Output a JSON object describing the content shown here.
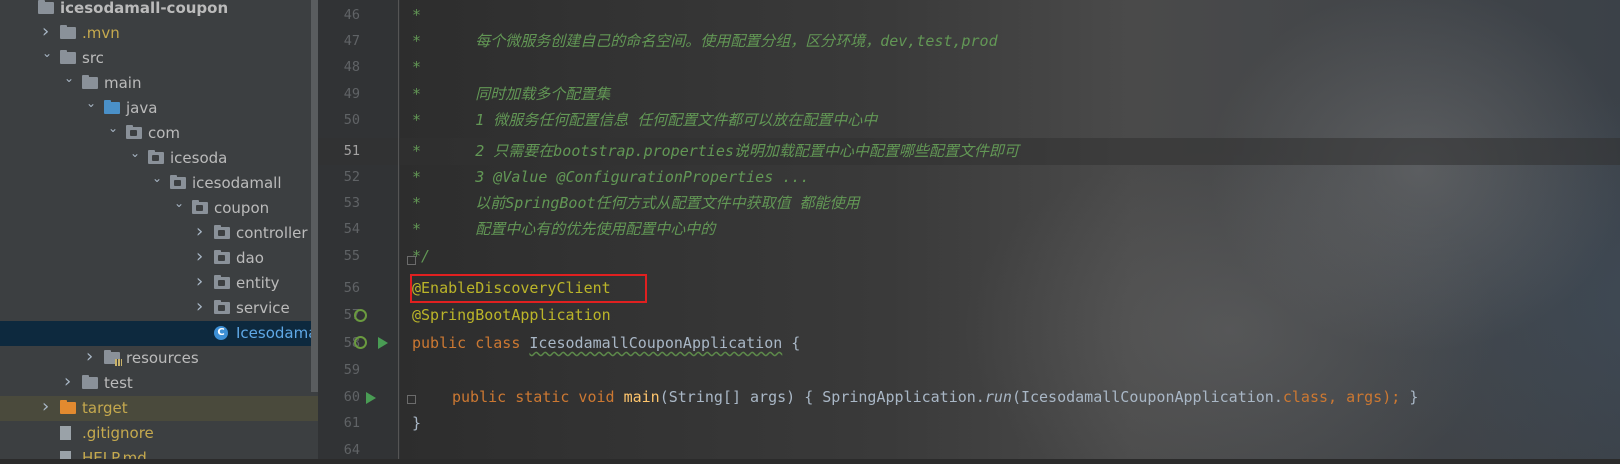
{
  "project_tree": {
    "items": [
      {
        "label": "icesodamall-coupon",
        "depth": 0,
        "arrow": "",
        "icon": "module-folder",
        "bold": true
      },
      {
        "label": ".mvn",
        "depth": 1,
        "arrow": "right",
        "icon": "folder",
        "color": "#c5a94e"
      },
      {
        "label": "src",
        "depth": 1,
        "arrow": "down",
        "icon": "folder"
      },
      {
        "label": "main",
        "depth": 2,
        "arrow": "down",
        "icon": "folder"
      },
      {
        "label": "java",
        "depth": 3,
        "arrow": "down",
        "icon": "source-folder"
      },
      {
        "label": "com",
        "depth": 4,
        "arrow": "down",
        "icon": "package"
      },
      {
        "label": "icesoda",
        "depth": 5,
        "arrow": "down",
        "icon": "package"
      },
      {
        "label": "icesodamall",
        "depth": 6,
        "arrow": "down",
        "icon": "package"
      },
      {
        "label": "coupon",
        "depth": 7,
        "arrow": "down",
        "icon": "package"
      },
      {
        "label": "controller",
        "depth": 8,
        "arrow": "right",
        "icon": "package"
      },
      {
        "label": "dao",
        "depth": 8,
        "arrow": "right",
        "icon": "package"
      },
      {
        "label": "entity",
        "depth": 8,
        "arrow": "right",
        "icon": "package"
      },
      {
        "label": "service",
        "depth": 8,
        "arrow": "right",
        "icon": "package"
      },
      {
        "label": "IcesodamallCouponApplication",
        "depth": 8,
        "arrow": "",
        "icon": "spring-class",
        "selected": true
      },
      {
        "label": "resources",
        "depth": 3,
        "arrow": "right",
        "icon": "resources-folder"
      },
      {
        "label": "test",
        "depth": 2,
        "arrow": "right",
        "icon": "folder"
      },
      {
        "label": "target",
        "depth": 1,
        "arrow": "right",
        "icon": "excluded-folder",
        "color": "#c5a94e",
        "highlight": true
      },
      {
        "label": ".gitignore",
        "depth": 1,
        "arrow": "",
        "icon": "file",
        "color": "#c5a94e"
      },
      {
        "label": "HELP.md",
        "depth": 1,
        "arrow": "",
        "icon": "file",
        "color": "#c5a94e"
      }
    ]
  },
  "editor": {
    "line_numbers": [
      "46",
      "47",
      "48",
      "49",
      "50",
      "51",
      "52",
      "53",
      "54",
      "55",
      "56",
      "57",
      "58",
      "59",
      "60",
      "61",
      "64"
    ],
    "current_line": "51",
    "lines": {
      "l46": "*",
      "l47": "*      每个微服务创建自己的命名空间。使用配置分组，区分环境，dev,test,prod",
      "l48": "*",
      "l49": "*      同时加载多个配置集",
      "l50": "*      1 微服务任何配置信息 任何配置文件都可以放在配置中心中",
      "l51": "*      2 只需要在bootstrap.properties说明加载配置中心中配置哪些配置文件即可",
      "l52": "*      3 @Value @ConfigurationProperties ...",
      "l53": "*      以前SpringBoot任何方式从配置文件中获取值 都能使用",
      "l54": "*      配置中心有的优先使用配置中心中的",
      "l55": "*/",
      "l56": "@EnableDiscoveryClient",
      "l57": "@SpringBootApplication",
      "l58_kw": "public class ",
      "l58_name": "IcesodamallCouponApplication",
      "l58_rest": " {",
      "l60_kw": "public static void ",
      "l60_fn": "main",
      "l60_a": "(String[] args) ",
      "l60_b": "{ SpringApplication.",
      "l60_run": "run",
      "l60_c": "(IcesodamallCouponApplication.",
      "l60_class": "class",
      "l60_d": ", args); ",
      "l60_e": "}",
      "l61": "}"
    }
  }
}
